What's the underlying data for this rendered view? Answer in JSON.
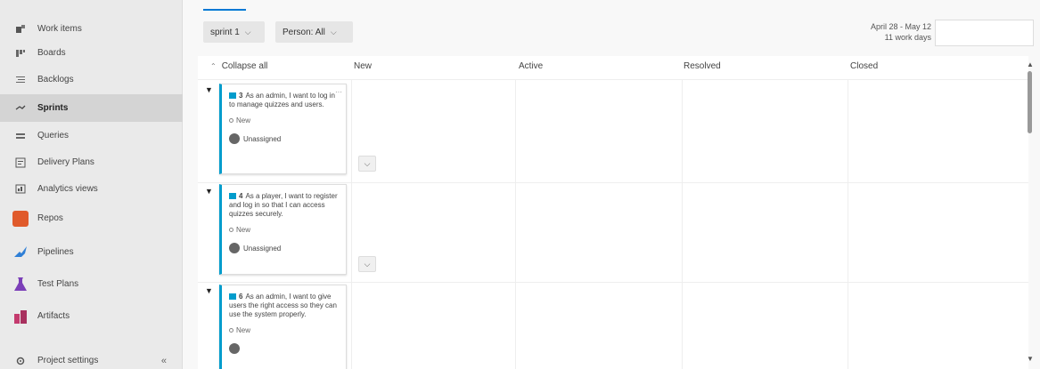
{
  "sidebar": {
    "items": [
      {
        "label": "Work items",
        "icon": "work-items-icon"
      },
      {
        "label": "Boards",
        "icon": "boards-icon"
      },
      {
        "label": "Backlogs",
        "icon": "backlogs-icon"
      },
      {
        "label": "Sprints",
        "icon": "sprints-icon",
        "active": true
      },
      {
        "label": "Queries",
        "icon": "queries-icon"
      },
      {
        "label": "Delivery Plans",
        "icon": "delivery-plans-icon"
      },
      {
        "label": "Analytics views",
        "icon": "analytics-icon"
      },
      {
        "label": "Repos",
        "icon": "repos-icon",
        "color": "#e05a2b"
      },
      {
        "label": "Pipelines",
        "icon": "pipelines-icon",
        "color": "#2f7fd6"
      },
      {
        "label": "Test Plans",
        "icon": "test-plans-icon",
        "color": "#7b3fb8"
      },
      {
        "label": "Artifacts",
        "icon": "artifacts-icon",
        "color": "#c43b6e"
      }
    ],
    "settings_label": "Project settings",
    "collapse_glyph": "«"
  },
  "toolbar": {
    "sprint_label": "sprint 1",
    "person_label": "Person: All",
    "date_range": "April 28 - May 12",
    "work_days": "11 work days"
  },
  "board": {
    "collapse_all": "Collapse all",
    "columns": [
      "New",
      "Active",
      "Resolved",
      "Closed"
    ],
    "cards": [
      {
        "id": "3",
        "title": "As an admin, I want to log in to manage quizzes and users.",
        "state": "New",
        "assignee": "Unassigned"
      },
      {
        "id": "4",
        "title": "As a player, I want to register and log in so that I can access quizzes securely.",
        "state": "New",
        "assignee": "Unassigned"
      },
      {
        "id": "6",
        "title": "As an admin, I want to give users the right access so they can use the system properly.",
        "state": "New",
        "assignee": ""
      }
    ]
  },
  "colors": {
    "accent": "#0078d4",
    "card_border": "#009ccc"
  }
}
